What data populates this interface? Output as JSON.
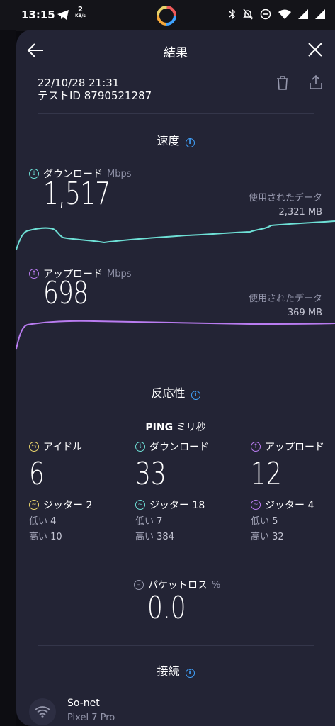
{
  "status_bar": {
    "time": "13:15",
    "net_speed_value": "2",
    "net_speed_unit": "KB/s"
  },
  "header": {
    "title": "結果"
  },
  "result": {
    "date": "22/10/28 21:31",
    "test_id": "テストID 8790521287"
  },
  "speed": {
    "section_title": "速度",
    "download": {
      "label": "ダウンロード",
      "unit": "Mbps",
      "value": "1,517",
      "used_label": "使用されたデータ",
      "used_value": "2,321 MB",
      "color": "#6ee0d6"
    },
    "upload": {
      "label": "アップロード",
      "unit": "Mbps",
      "value": "698",
      "used_label": "使用されたデータ",
      "used_value": "369 MB",
      "color": "#b97cf0"
    }
  },
  "responsiveness": {
    "section_title": "反応性",
    "ping_label": "PING",
    "ping_unit": "ミリ秒",
    "idle": {
      "label": "アイドル",
      "value": "6",
      "jitter": "ジッター 2",
      "low": "4",
      "high": "10",
      "color": "#e8d36b"
    },
    "download": {
      "label": "ダウンロード",
      "value": "33",
      "jitter": "ジッター 18",
      "low": "7",
      "high": "384",
      "color": "#6ee0d6"
    },
    "upload": {
      "label": "アップロード",
      "value": "12",
      "jitter": "ジッター 4",
      "low": "5",
      "high": "32",
      "color": "#b97cf0"
    },
    "low_label": "低い",
    "high_label": "高い",
    "packet_loss_label": "パケットロス",
    "packet_loss_unit": "%",
    "packet_loss_value": "0.0"
  },
  "connection": {
    "section_title": "接続",
    "isp": "So-net",
    "device": "Pixel 7 Pro"
  }
}
